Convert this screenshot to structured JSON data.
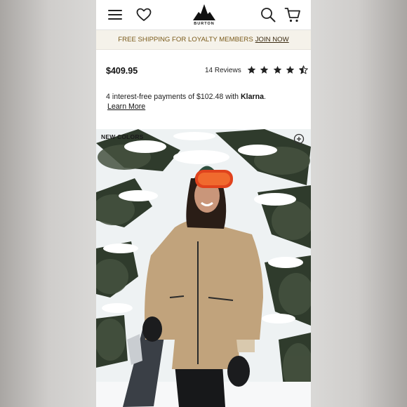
{
  "header": {
    "logo_text": "BURTON",
    "icons": [
      "menu-icon",
      "heart-icon",
      "burton-mountain-logo",
      "search-icon",
      "cart-icon"
    ]
  },
  "promo": {
    "text": "FREE SHIPPING FOR LOYALTY MEMBERS",
    "link": "JOIN NOW"
  },
  "product": {
    "price": "$409.95",
    "reviews": "14 Reviews",
    "rating": 4.5,
    "rating_max": 5
  },
  "klarna": {
    "text": "4 interest-free payments of $102.48 with",
    "brand": "Klarna",
    "suffix": ".",
    "link": "Learn More"
  },
  "image": {
    "badge": "NEW COLORS"
  },
  "colors": {
    "promo_bg": "#f5f2ea",
    "promo_text": "#7a5a1a",
    "jacket": "#c1a37c"
  }
}
